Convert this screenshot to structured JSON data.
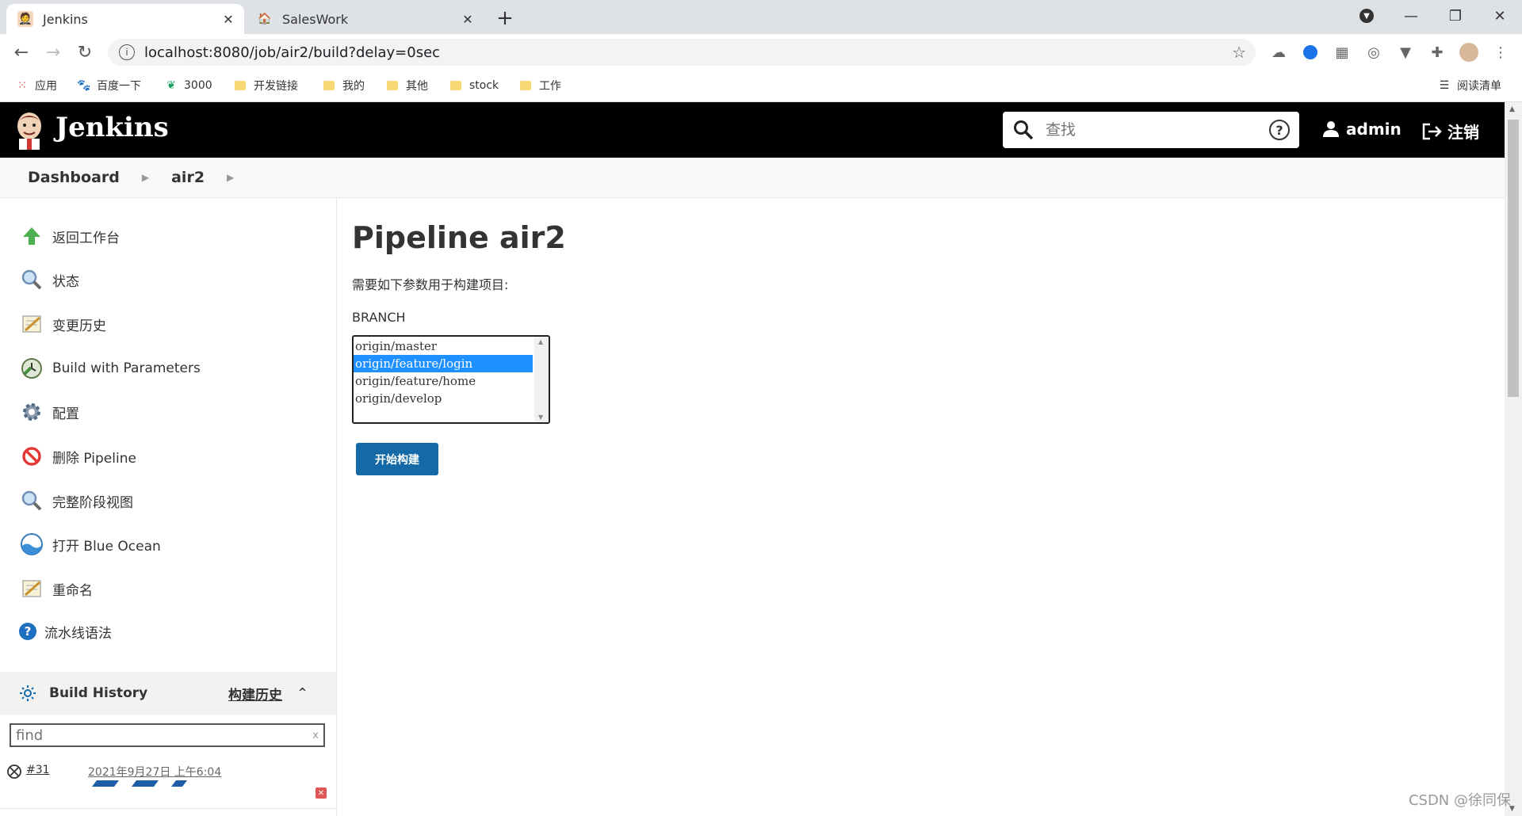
{
  "browser": {
    "tabs": [
      {
        "title": "Jenkins",
        "active": true
      },
      {
        "title": "SalesWork",
        "active": false
      }
    ],
    "url": "localhost:8080/job/air2/build?delay=0sec",
    "bookmarks": [
      {
        "label": "应用",
        "icon": "apps-grid-icon"
      },
      {
        "label": "百度一下",
        "icon": "baidu-paw-icon"
      },
      {
        "label": "3000",
        "icon": "plant-icon"
      },
      {
        "label": "开发链接",
        "icon": "folder-icon"
      },
      {
        "label": "我的",
        "icon": "folder-icon"
      },
      {
        "label": "其他",
        "icon": "folder-icon"
      },
      {
        "label": "stock",
        "icon": "folder-icon"
      },
      {
        "label": "工作",
        "icon": "folder-icon"
      }
    ],
    "reading_list": "阅读清单"
  },
  "header": {
    "brand": "Jenkins",
    "search_placeholder": "查找",
    "user": "admin",
    "logout": "注销"
  },
  "breadcrumb": [
    {
      "label": "Dashboard"
    },
    {
      "label": "air2"
    }
  ],
  "sidebar": {
    "items": [
      {
        "label": "返回工作台",
        "icon": "up-arrow-icon"
      },
      {
        "label": "状态",
        "icon": "magnifier-icon"
      },
      {
        "label": "变更历史",
        "icon": "notepad-icon"
      },
      {
        "label": "Build with Parameters",
        "icon": "clock-build-icon"
      },
      {
        "label": "配置",
        "icon": "gear-icon"
      },
      {
        "label": "删除 Pipeline",
        "icon": "no-entry-icon"
      },
      {
        "label": "完整阶段视图",
        "icon": "magnifier-icon"
      },
      {
        "label": "打开 Blue Ocean",
        "icon": "blue-ocean-icon"
      },
      {
        "label": "重命名",
        "icon": "notepad-icon"
      },
      {
        "label": "流水线语法",
        "icon": "help-icon"
      }
    ],
    "build_history": {
      "title": "Build History",
      "link": "构建历史",
      "filter_placeholder": "find",
      "builds": [
        {
          "number": "#31",
          "date": "2021年9月27日 上午6:04",
          "status": "aborted"
        }
      ]
    }
  },
  "main": {
    "title": "Pipeline air2",
    "description": "需要如下参数用于构建项目:",
    "param_label": "BRANCH",
    "options": [
      "origin/master",
      "origin/feature/login",
      "origin/feature/home",
      "origin/develop"
    ],
    "selected_index": 1,
    "submit": "开始构建"
  },
  "watermark": "CSDN @徐同保",
  "colors": {
    "accent": "#1469a6",
    "selection": "#1e90ff",
    "header_bg": "#000000"
  }
}
